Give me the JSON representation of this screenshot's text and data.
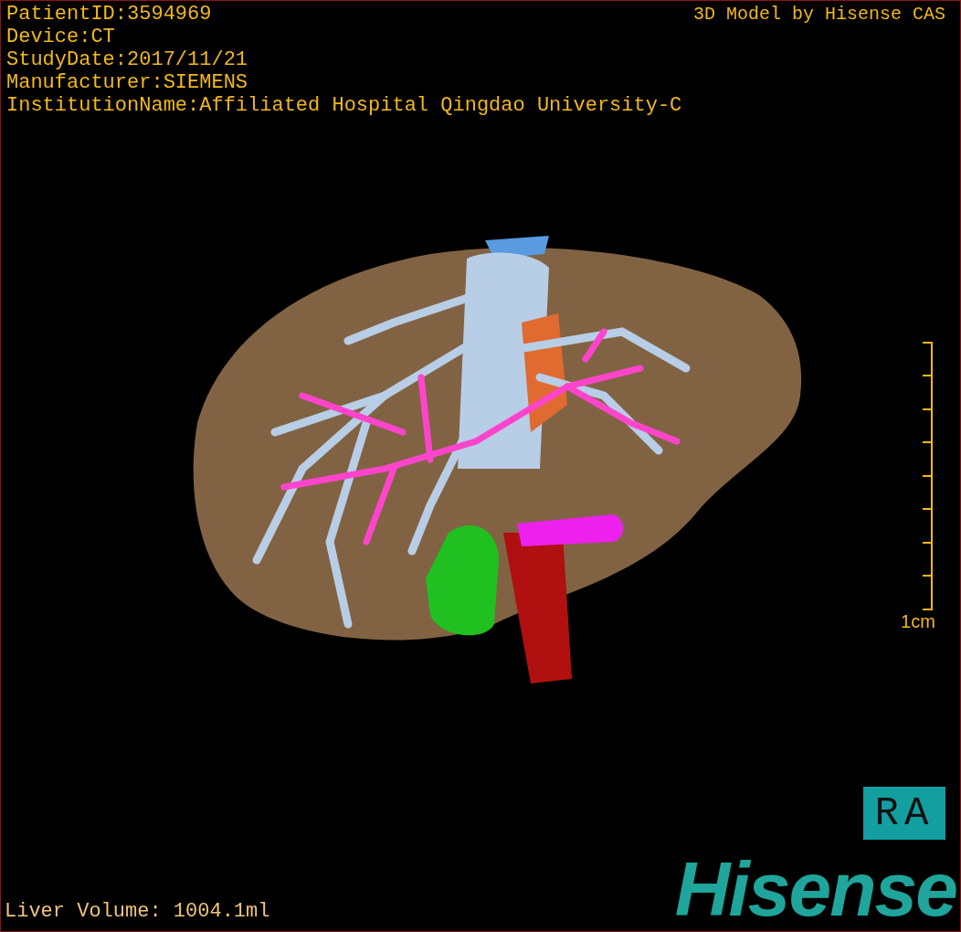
{
  "header": {
    "info": [
      "PatientID:3594969",
      "Device:CT",
      "StudyDate:2017/11/21",
      "Manufacturer:SIEMENS",
      "InstitutionName:Affiliated Hospital Qingdao University-C"
    ],
    "title": "3D Model by Hisense CAS"
  },
  "scale": {
    "label": "1cm"
  },
  "orientation_marker": "RA",
  "liver_volume": "Liver Volume: 1004.1ml",
  "logo": "Hisense"
}
